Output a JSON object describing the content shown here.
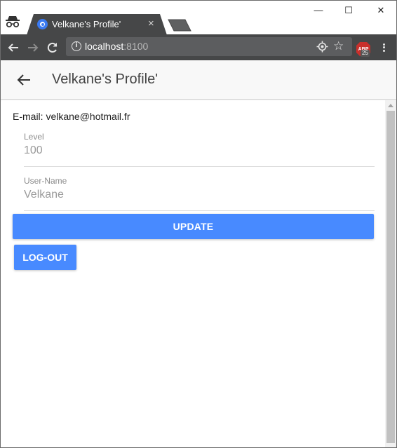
{
  "browser": {
    "tab_title": "Velkane's Profile'",
    "tab_close_glyph": "×",
    "url_host": "localhost",
    "url_port": ":8100",
    "window_min": "—",
    "window_max": "☐",
    "window_close": "✕",
    "extension_badge": "25",
    "icons": [
      "incognito-icon",
      "back-icon",
      "forward-icon",
      "reload-icon",
      "info-icon",
      "location-icon",
      "star-icon",
      "adblock-icon",
      "menu-icon"
    ]
  },
  "app": {
    "title": "Velkane's Profile'",
    "email_text": "E-mail: velkane@hotmail.fr",
    "level": {
      "label": "Level",
      "placeholder": "100"
    },
    "username": {
      "label": "User-Name",
      "placeholder": "Velkane"
    },
    "update_label": "UPDATE",
    "logout_label": "LOG-OUT"
  },
  "colors": {
    "primary": "#488aff",
    "toolbar": "#464748",
    "tab": "#464748"
  }
}
